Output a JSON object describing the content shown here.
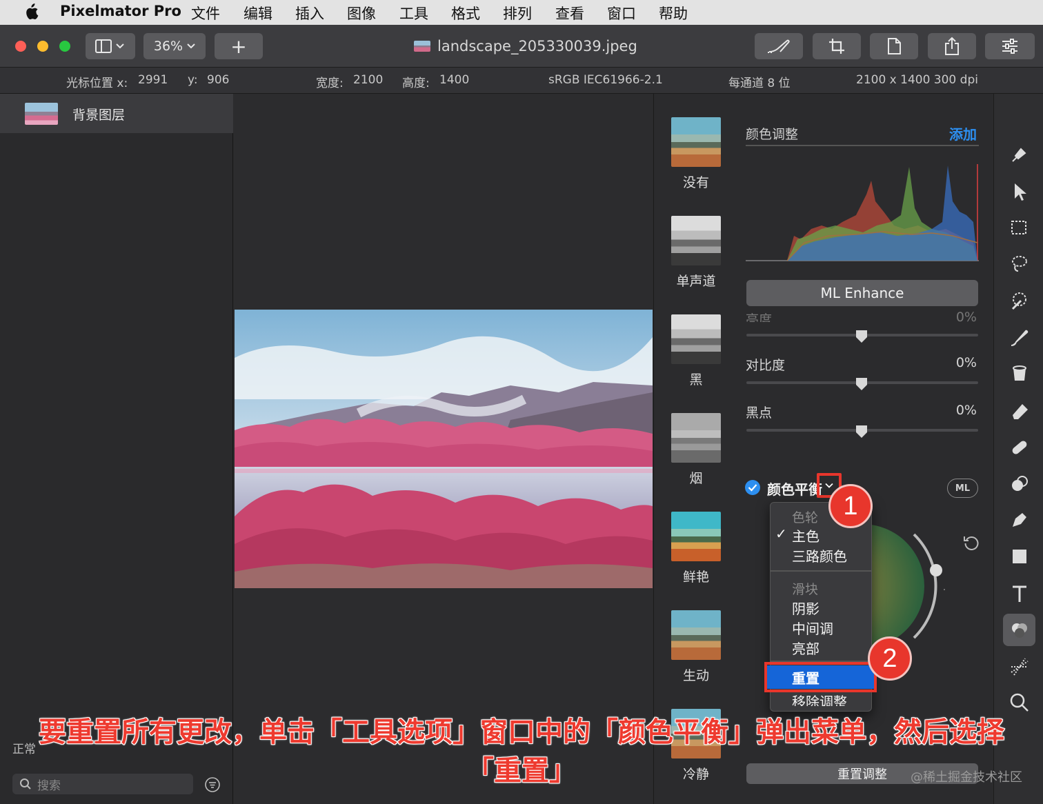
{
  "menubar": {
    "app_name": "Pixelmator Pro",
    "items": [
      "文件",
      "编辑",
      "插入",
      "图像",
      "工具",
      "格式",
      "排列",
      "查看",
      "窗口",
      "帮助"
    ]
  },
  "titlebar": {
    "zoom": "36%",
    "add_label": "+",
    "filename": "landscape_205330039.jpeg"
  },
  "infobar": {
    "cursor_label": "光标位置 x:",
    "cursor_x": "2991",
    "cursor_y_label": "y:",
    "cursor_y": "906",
    "width_label": "宽度:",
    "width_value": "2100",
    "height_label": "高度:",
    "height_value": "1400",
    "color_profile": "sRGB IEC61966-2.1",
    "bit_depth": "每通道 8 位",
    "resolution": "2100 x 1400 300 dpi"
  },
  "layers": {
    "items": [
      {
        "name": "背景图层"
      }
    ],
    "blend_label": "正常",
    "search_placeholder": "搜索"
  },
  "presets": [
    {
      "label": "没有",
      "style": "color"
    },
    {
      "label": "单声道",
      "style": "mono"
    },
    {
      "label": "黑",
      "style": "mono"
    },
    {
      "label": "烟",
      "style": "smoke"
    },
    {
      "label": "鲜艳",
      "style": "vivid"
    },
    {
      "label": "生动",
      "style": "color"
    },
    {
      "label": "冷静",
      "style": "color"
    }
  ],
  "adjustments": {
    "title": "颜色调整",
    "add_label": "添加",
    "ml_enhance": "ML Enhance",
    "sliders": [
      {
        "label": "亮度",
        "value": "0%"
      },
      {
        "label": "对比度",
        "value": "0%"
      },
      {
        "label": "黑点",
        "value": "0%"
      }
    ],
    "color_balance_label": "颜色平衡",
    "ml_pill": "ML",
    "reset_adjustments": "重置调整",
    "colors": {
      "accent": "#2d8ff0",
      "highlight_box": "#e8362c",
      "menu_selected": "#1565d8"
    }
  },
  "dropdown": {
    "section1_header": "色轮",
    "section1_items": [
      {
        "label": "主色",
        "checked": true
      },
      {
        "label": "三路颜色",
        "checked": false
      }
    ],
    "section2_header": "滑块",
    "section2_items": [
      "阴影",
      "中间调",
      "亮部"
    ],
    "reset": "重置",
    "remove": "移除调整"
  },
  "badges": [
    "1",
    "2"
  ],
  "tools": [
    "paint-icon",
    "arrow-icon",
    "rect-select-icon",
    "lasso-icon",
    "magic-wand-icon",
    "brush-icon",
    "bucket-icon",
    "eraser-icon",
    "bandage-icon",
    "clone-icon",
    "pen-icon",
    "shape-icon",
    "text-icon",
    "color-adjust-icon",
    "effects-icon",
    "zoom-icon"
  ],
  "caption": "要重置所有更改，单击「工具选项」窗口中的「颜色平衡」弹出菜单，然后选择「重置」",
  "watermark": "@稀土掘金技术社区"
}
